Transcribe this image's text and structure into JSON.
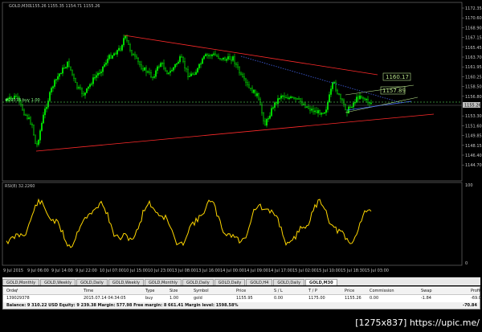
{
  "window": {
    "symbol_title": "GOLD,M30",
    "ohlc": "1155.26 1155.35 1154.71 1155.26",
    "indicator_label": "RSI(8) 32.2260",
    "position_label": "#29378 buy 1.00"
  },
  "price_axis": {
    "labels": [
      "1172.35",
      "1170.60",
      "1168.90",
      "1167.15",
      "1165.45",
      "1163.70",
      "1161.95",
      "1160.25",
      "1158.50",
      "1156.80",
      "1155.26",
      "1153.30",
      "1151.60",
      "1149.85",
      "1148.15",
      "1146.40",
      "1144.70"
    ],
    "current_price": "1155.26"
  },
  "rsi_axis": {
    "labels": [
      "100",
      "0"
    ]
  },
  "time_axis": {
    "labels": [
      "9 Jul 2015",
      "9 Jul 06:00",
      "9 Jul 14:00",
      "9 Jul 22:00",
      "10 Jul 07:00",
      "10 Jul 15:00",
      "10 Jul 23:00",
      "13 Jul 08:00",
      "13 Jul 16:00",
      "14 Jul 00:00",
      "14 Jul 09:00",
      "14 Jul 17:00",
      "15 Jul 02:00",
      "15 Jul 10:00",
      "15 Jul 18:30",
      "15 Jul 03:00"
    ]
  },
  "annotations": {
    "target_upper": "1160.17",
    "target_lower": "1157.89"
  },
  "colors": {
    "background": "#000000",
    "bull_candle": "#00ff00",
    "bear_candle": "#00ff00",
    "resistance_line": "#ff2a2a",
    "rsi_line": "#ffd700",
    "position_line": "#44aa44",
    "target_box": "#b6e28a",
    "dotted_projection": "#4a6cff"
  },
  "chart_tabs": [
    "GOLD,Monthly",
    "GOLD,Weekly",
    "GOLD,Daily",
    "GOLD,Weekly",
    "GOLD,Monthly",
    "GOLD,Daily",
    "GOLD,Daily",
    "GOLD,H4",
    "GOLD,Daily",
    "GOLD,M30"
  ],
  "active_tab": "GOLD,M30",
  "trade": {
    "headers": [
      "Order",
      "/",
      "Time",
      "Type",
      "Size",
      "Symbol",
      "Price",
      "S / L",
      "T / P",
      "Price",
      "Commission",
      "Swap",
      "Profit"
    ],
    "row": [
      "139029378",
      "",
      "2015.07.14 04:34:05",
      "buy",
      "1.00",
      "gold",
      "1155.95",
      "0.00",
      "1175.00",
      "1155.26",
      "0.00",
      "-1.84",
      "-69.00"
    ],
    "balance": "Balance: 9 310.22 USD  Equity: 9 239.38  Margin: 577.98  Free margin: 8 661.41  Margin level: 1598.58%",
    "total": "-70.84"
  },
  "watermark": "[1275x837] https://upic.me/"
}
